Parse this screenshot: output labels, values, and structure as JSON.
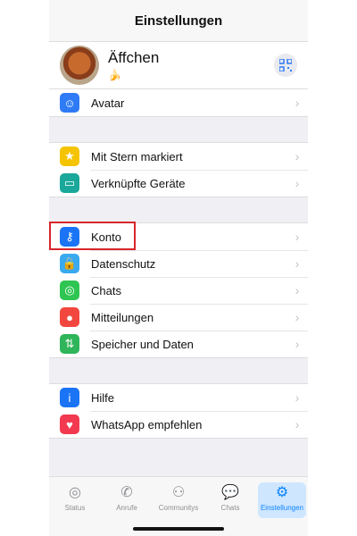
{
  "header": {
    "title": "Einstellungen"
  },
  "profile": {
    "name": "Äffchen",
    "status": "🍌",
    "qr_icon": "qr-code-icon"
  },
  "groups": [
    {
      "items": [
        {
          "label": "Avatar",
          "icon": "avatar-icon",
          "color": "#2f7bf6"
        }
      ]
    },
    {
      "items": [
        {
          "label": "Mit Stern markiert",
          "icon": "star-icon",
          "color": "#f5c400"
        },
        {
          "label": "Verknüpfte Geräte",
          "icon": "laptop-icon",
          "color": "#1aa89a"
        }
      ]
    },
    {
      "items": [
        {
          "label": "Konto",
          "icon": "key-icon",
          "color": "#1a74f5"
        },
        {
          "label": "Datenschutz",
          "icon": "lock-icon",
          "color": "#39a9f0"
        },
        {
          "label": "Chats",
          "icon": "whatsapp-icon",
          "color": "#2fc552"
        },
        {
          "label": "Mitteilungen",
          "icon": "notification-icon",
          "color": "#f2473f"
        },
        {
          "label": "Speicher und Daten",
          "icon": "storage-icon",
          "color": "#2fb55a"
        }
      ]
    },
    {
      "items": [
        {
          "label": "Hilfe",
          "icon": "info-icon",
          "color": "#1a74f5"
        },
        {
          "label": "WhatsApp empfehlen",
          "icon": "heart-icon",
          "color": "#f2394f"
        }
      ]
    }
  ],
  "tabs": [
    {
      "label": "Status",
      "icon": "status-icon",
      "active": false
    },
    {
      "label": "Anrufe",
      "icon": "phone-icon",
      "active": false
    },
    {
      "label": "Communitys",
      "icon": "communities-icon",
      "active": false
    },
    {
      "label": "Chats",
      "icon": "chats-icon",
      "active": false
    },
    {
      "label": "Einstellungen",
      "icon": "settings-icon",
      "active": true
    }
  ]
}
